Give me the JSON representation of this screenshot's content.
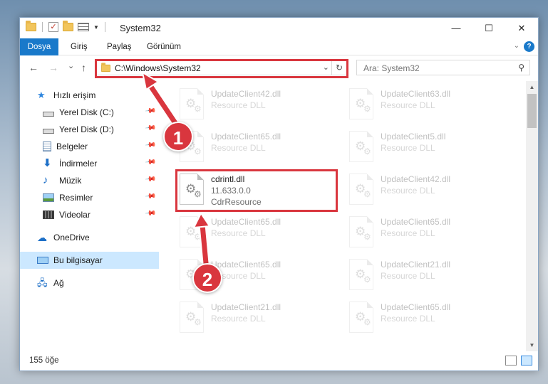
{
  "window": {
    "title": "System32",
    "controls": {
      "minimize": "—",
      "maximize": "☐",
      "close": "✕"
    }
  },
  "ribbon": {
    "tabs": [
      "Dosya",
      "Giriş",
      "Paylaş",
      "Görünüm"
    ],
    "help": "?"
  },
  "nav": {
    "back": "←",
    "forward": "→",
    "recent": "⌄",
    "up": "↑",
    "address": "C:\\Windows\\System32",
    "refresh": "↻",
    "search_placeholder": "Ara: System32"
  },
  "sidebar": {
    "items": [
      {
        "label": "Hızlı erişim",
        "icon": "star-icon"
      },
      {
        "label": "Yerel Disk (C:)",
        "icon": "drive-icon",
        "pinned": true
      },
      {
        "label": "Yerel Disk (D:)",
        "icon": "drive-icon",
        "pinned": true
      },
      {
        "label": "Belgeler",
        "icon": "documents-icon",
        "pinned": true
      },
      {
        "label": "İndirmeler",
        "icon": "download-icon",
        "pinned": true
      },
      {
        "label": "Müzik",
        "icon": "music-icon",
        "pinned": true
      },
      {
        "label": "Resimler",
        "icon": "pictures-icon",
        "pinned": true
      },
      {
        "label": "Videolar",
        "icon": "video-icon",
        "pinned": true
      },
      {
        "label": "OneDrive",
        "icon": "cloud-icon"
      },
      {
        "label": "Bu bilgisayar",
        "icon": "computer-icon",
        "selected": true
      },
      {
        "label": "Ağ",
        "icon": "network-icon"
      }
    ]
  },
  "files": {
    "left_column": [
      {
        "name": "UpdateClient42.dll",
        "type": "Resource DLL"
      },
      {
        "name": "UpdateClient65.dll",
        "type": "Resource DLL"
      },
      {
        "name": "cdrintl.dll",
        "version": "11.633.0.0",
        "type": "CdrResource",
        "highlighted": true
      },
      {
        "name": "UpdateClient65.dll",
        "type": "Resource DLL"
      },
      {
        "name": "UpdateClient65.dll",
        "type": "Resource DLL"
      },
      {
        "name": "UpdateClient21.dll",
        "type": "Resource DLL"
      }
    ],
    "right_column": [
      {
        "name": "UpdateClient63.dll",
        "type": "Resource DLL"
      },
      {
        "name": "UpdateClient5.dll",
        "type": "Resource DLL"
      },
      {
        "name": "UpdateClient42.dll",
        "type": "Resource DLL"
      },
      {
        "name": "UpdateClient65.dll",
        "type": "Resource DLL"
      },
      {
        "name": "UpdateClient21.dll",
        "type": "Resource DLL"
      },
      {
        "name": "UpdateClient65.dll",
        "type": "Resource DLL"
      }
    ]
  },
  "status": {
    "count": "155 öğe"
  },
  "annotations": {
    "step1": "1",
    "step2": "2",
    "color": "#d9363e"
  }
}
